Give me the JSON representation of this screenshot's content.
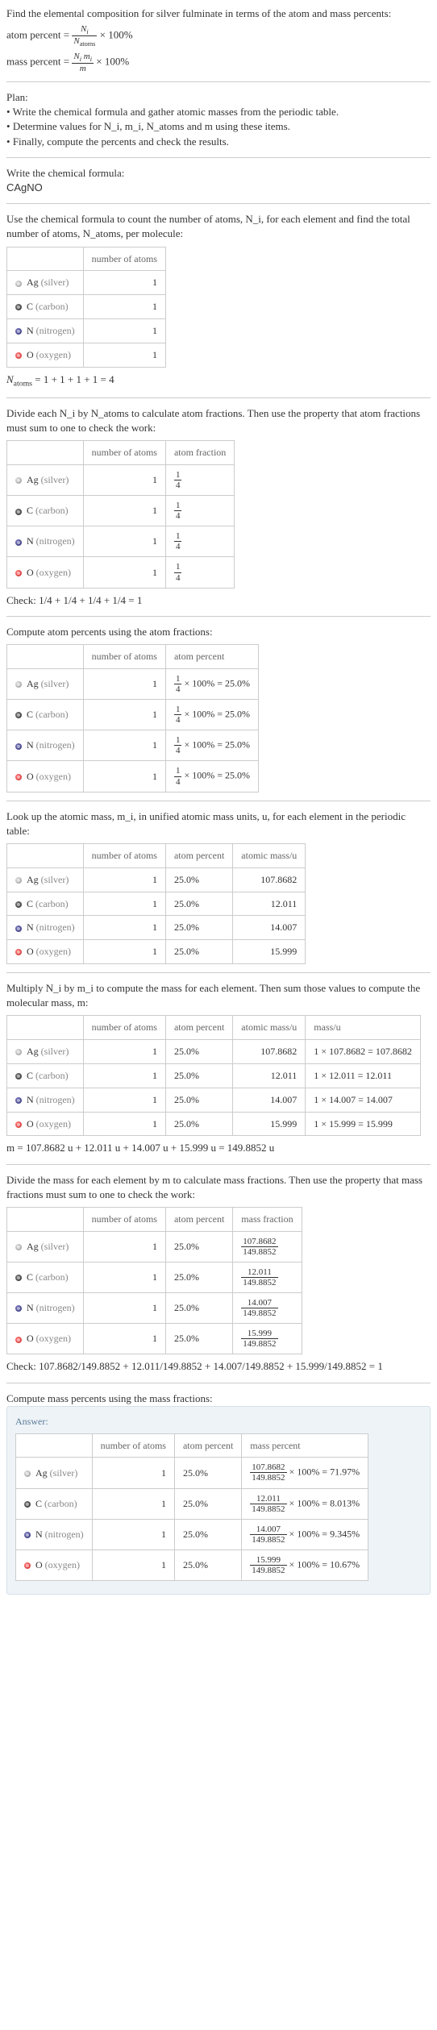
{
  "intro": {
    "line1": "Find the elemental composition for silver fulminate in terms of the atom and mass percents:",
    "atom_percent_label": "atom percent",
    "mass_percent_label": "mass percent",
    "eq_times100": " × 100%"
  },
  "plan": {
    "heading": "Plan:",
    "items": [
      "Write the chemical formula and gather atomic masses from the periodic table.",
      "Determine values for N_i, m_i, N_atoms and m using these items.",
      "Finally, compute the percents and check the results."
    ]
  },
  "formula_section": {
    "line": "Write the chemical formula:",
    "formula": "CAgNO"
  },
  "count_section": {
    "intro": "Use the chemical formula to count the number of atoms, N_i, for each element and find the total number of atoms, N_atoms, per molecule:",
    "natoms_line": "N_atoms = 1 + 1 + 1 + 1 = 4"
  },
  "headers": {
    "number_of_atoms": "number of atoms",
    "atom_fraction": "atom fraction",
    "atom_percent": "atom percent",
    "atomic_mass": "atomic mass/u",
    "mass_u": "mass/u",
    "mass_fraction": "mass fraction",
    "mass_percent": "mass percent"
  },
  "elements": [
    {
      "sym": "Ag",
      "name": "silver",
      "cls": "b-ag",
      "count": "1",
      "frac": "1/4",
      "pct": "1/4 × 100% = 25.0%",
      "pct_short": "25.0%",
      "amass": "107.8682",
      "mass_calc": "1 × 107.8682 = 107.8682",
      "mfrac_num": "107.8682",
      "mpct": "107.8682/149.8852 × 100% = 71.97%"
    },
    {
      "sym": "C",
      "name": "carbon",
      "cls": "b-c",
      "count": "1",
      "frac": "1/4",
      "pct": "1/4 × 100% = 25.0%",
      "pct_short": "25.0%",
      "amass": "12.011",
      "mass_calc": "1 × 12.011 = 12.011",
      "mfrac_num": "12.011",
      "mpct": "12.011/149.8852 × 100% = 8.013%"
    },
    {
      "sym": "N",
      "name": "nitrogen",
      "cls": "b-n",
      "count": "1",
      "frac": "1/4",
      "pct": "1/4 × 100% = 25.0%",
      "pct_short": "25.0%",
      "amass": "14.007",
      "mass_calc": "1 × 14.007 = 14.007",
      "mfrac_num": "14.007",
      "mpct": "14.007/149.8852 × 100% = 9.345%"
    },
    {
      "sym": "O",
      "name": "oxygen",
      "cls": "b-o",
      "count": "1",
      "frac": "1/4",
      "pct": "1/4 × 100% = 25.0%",
      "pct_short": "25.0%",
      "amass": "15.999",
      "mass_calc": "1 × 15.999 = 15.999",
      "mfrac_num": "15.999",
      "mpct": "15.999/149.8852 × 100% = 10.67%"
    }
  ],
  "mfrac_den": "149.8852",
  "atom_frac_section": {
    "intro": "Divide each N_i by N_atoms to calculate atom fractions. Then use the property that atom fractions must sum to one to check the work:",
    "check": "Check: 1/4 + 1/4 + 1/4 + 1/4 = 1"
  },
  "atom_pct_section": {
    "intro": "Compute atom percents using the atom fractions:"
  },
  "amass_section": {
    "intro": "Look up the atomic mass, m_i, in unified atomic mass units, u, for each element in the periodic table:"
  },
  "molmass_section": {
    "intro": "Multiply N_i by m_i to compute the mass for each element. Then sum those values to compute the molecular mass, m:",
    "result": "m = 107.8682 u + 12.011 u + 14.007 u + 15.999 u = 149.8852 u"
  },
  "massfrac_section": {
    "intro": "Divide the mass for each element by m to calculate mass fractions. Then use the property that mass fractions must sum to one to check the work:",
    "check": "Check: 107.8682/149.8852 + 12.011/149.8852 + 14.007/149.8852 + 15.999/149.8852 = 1"
  },
  "masspct_section": {
    "intro": "Compute mass percents using the mass fractions:"
  },
  "answer_label": "Answer:"
}
